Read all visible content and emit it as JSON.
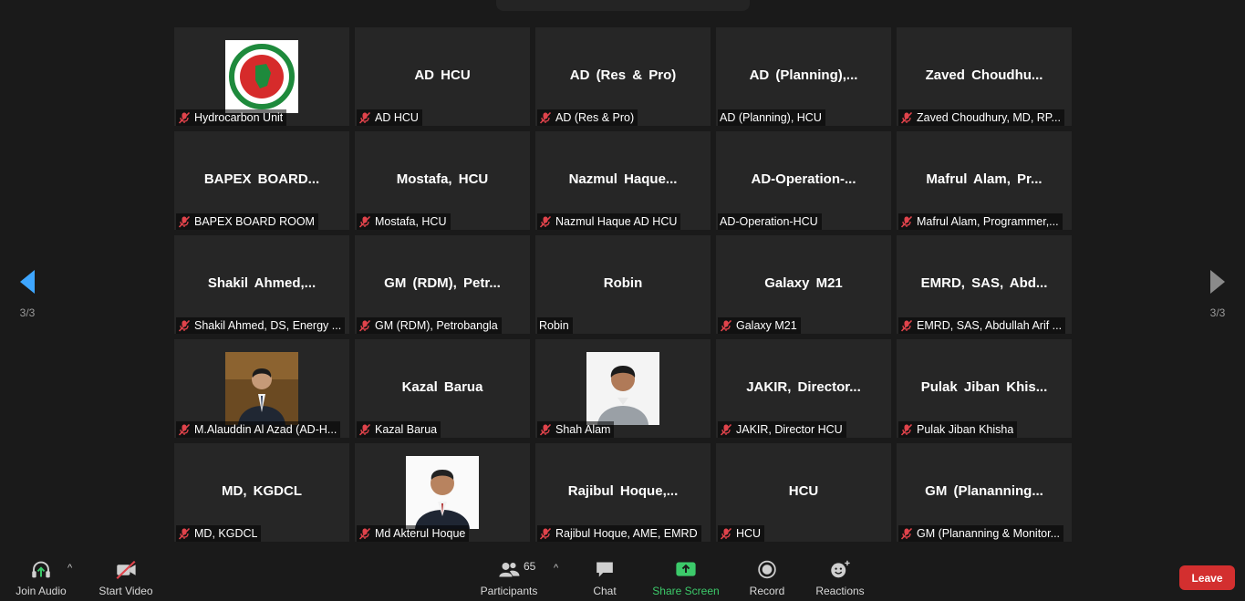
{
  "page_indicator": "3/3",
  "participants": [
    {
      "title": "",
      "name": "Hydrocarbon Unit",
      "muted": true,
      "image": "gov-seal"
    },
    {
      "title": "AD HCU",
      "name": "AD HCU",
      "muted": true
    },
    {
      "title": "AD (Res & Pro)",
      "name": "AD (Res & Pro)",
      "muted": true
    },
    {
      "title": "AD  (Planning),...",
      "name": "AD (Planning), HCU",
      "muted": false
    },
    {
      "title": "Zaved  Choudhu...",
      "name": "Zaved Choudhury, MD, RP...",
      "muted": true
    },
    {
      "title": "BAPEX  BOARD...",
      "name": "BAPEX BOARD ROOM",
      "muted": true
    },
    {
      "title": "Mostafa, HCU",
      "name": "Mostafa, HCU",
      "muted": true
    },
    {
      "title": "Nazmul  Haque...",
      "name": "Nazmul Haque AD HCU",
      "muted": true
    },
    {
      "title": "AD-Operation-...",
      "name": "AD-Operation-HCU",
      "muted": false
    },
    {
      "title": "Mafrul Alam,  Pr...",
      "name": "Mafrul Alam, Programmer,...",
      "muted": true
    },
    {
      "title": "Shakil  Ahmed,...",
      "name": "Shakil Ahmed, DS, Energy ...",
      "muted": true
    },
    {
      "title": "GM (RDM),  Petr...",
      "name": "GM (RDM), Petrobangla",
      "muted": true
    },
    {
      "title": "Robin",
      "name": "Robin",
      "muted": false
    },
    {
      "title": "Galaxy M21",
      "name": "Galaxy M21",
      "muted": true
    },
    {
      "title": "EMRD,  SAS,  Abd...",
      "name": "EMRD, SAS, Abdullah Arif ...",
      "muted": true
    },
    {
      "title": "",
      "name": "M.Alauddin Al Azad (AD-H...",
      "muted": true,
      "image": "photo-suit"
    },
    {
      "title": "Kazal Barua",
      "name": "Kazal Barua",
      "muted": true
    },
    {
      "title": "",
      "name": "Shah Alam",
      "muted": true,
      "image": "photo-portrait"
    },
    {
      "title": "JAKIR,  Director...",
      "name": "JAKIR, Director HCU",
      "muted": true
    },
    {
      "title": "Pulak  Jiban  Khis...",
      "name": "Pulak Jiban Khisha",
      "muted": true
    },
    {
      "title": "MD, KGDCL",
      "name": "MD, KGDCL",
      "muted": true
    },
    {
      "title": "",
      "name": "Md Akterul Hoque",
      "muted": true,
      "image": "photo-portrait-2"
    },
    {
      "title": "Rajibul  Hoque,...",
      "name": "Rajibul Hoque, AME, EMRD",
      "muted": true
    },
    {
      "title": "HCU",
      "name": "HCU",
      "muted": true
    },
    {
      "title": "GM  (Plananning...",
      "name": "GM (Plananning & Monitor...",
      "muted": true
    }
  ],
  "toolbar": {
    "join_audio": "Join Audio",
    "start_video": "Start Video",
    "participants_label": "Participants",
    "participants_count": "65",
    "chat": "Chat",
    "share_screen": "Share Screen",
    "record": "Record",
    "reactions": "Reactions",
    "leave": "Leave"
  },
  "colors": {
    "background": "#1a1a1a",
    "tile": "#262626",
    "share_green": "#3cca6a",
    "leave_red": "#d32f2f",
    "nav_arrow_blue": "#3ea6ff",
    "muted_red": "#e0434b"
  }
}
